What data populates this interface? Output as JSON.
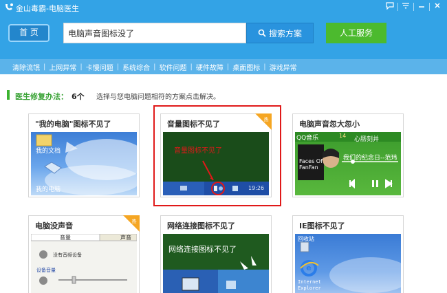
{
  "app": {
    "title": "金山毒霸-电脑医生"
  },
  "toolbar": {
    "home_label": "首 页",
    "search_value": "电脑声音图标没了",
    "search_button": "搜索方案",
    "manual_button": "人工服务"
  },
  "subnav": {
    "items": [
      "清除流氓",
      "上网异常",
      "卡慢问题",
      "系统综合",
      "软件问题",
      "硬件故障",
      "桌面图标",
      "游戏异常"
    ]
  },
  "doctor": {
    "title": "医生修复办法：",
    "count": "6个",
    "hint": "选择与您电脑问题相符的方案点击解决。"
  },
  "cards": [
    {
      "title": "\"我的电脑\"图标不见了",
      "thumb_labels": [
        "我的文档",
        "我的电脑"
      ]
    },
    {
      "title": "音量图标不见了",
      "hot": "热",
      "thumb_labels": [
        "音量图标不见了",
        "19:26"
      ]
    },
    {
      "title": "电脑声音忽大忽小",
      "thumb_labels": [
        "QQ音乐",
        "心肠刻并",
        "Faces Of FanFan",
        "我们的纪念日--范玮",
        "14"
      ]
    },
    {
      "title": "电脑没声音",
      "hot": "热",
      "thumb_labels": [
        "音量",
        "声音",
        "没有音频设备",
        "设备音量"
      ]
    },
    {
      "title": "网络连接图标不见了",
      "thumb_labels": [
        "网络连接图标不见了"
      ]
    },
    {
      "title": "IE图标不见了",
      "thumb_labels": [
        "回收站",
        "Internet Explorer"
      ]
    }
  ],
  "colors": {
    "header": "#33a3e6",
    "subnav": "#5bb3ea",
    "manual_button": "#4cba2e",
    "highlight": "#e01919",
    "doctor_accent": "#3bb32f"
  }
}
